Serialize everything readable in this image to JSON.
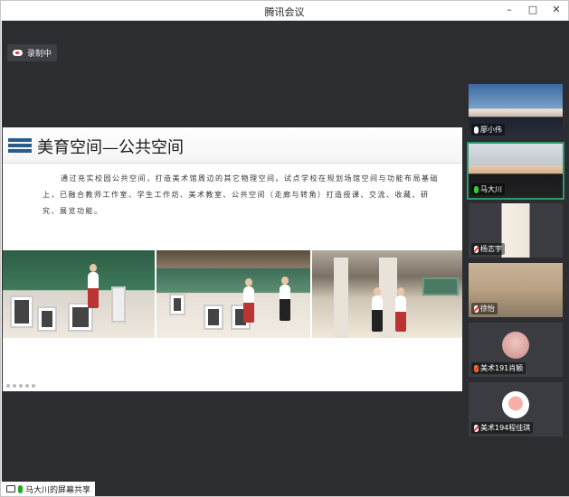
{
  "window": {
    "title": "腾讯会议",
    "minimize": "–",
    "maximize": "□",
    "close": "✕"
  },
  "recording": {
    "label": "录制中"
  },
  "slide": {
    "title": "美育空间—公共空间",
    "body": "通过充实校园公共空间，打造美术馆周边的其它物理空间。试点学校在规划场馆空间与功能布局基础上，已融合教师工作室、学生工作坊、美术教室、公共空间（走廊与转角）打造授课、交流、收藏、研究、展览功能。"
  },
  "screen_share": {
    "label": "马大川的屏幕共享"
  },
  "participants": [
    {
      "name": "廖小伟",
      "mic": "on"
    },
    {
      "name": "马大川",
      "mic": "active"
    },
    {
      "name": "杨志宇",
      "mic": "muted"
    },
    {
      "name": "徐怡",
      "mic": "muted"
    },
    {
      "name": "美术191肖颖",
      "mic": "muted"
    },
    {
      "name": "美术194程佳琪",
      "mic": "muted"
    }
  ]
}
